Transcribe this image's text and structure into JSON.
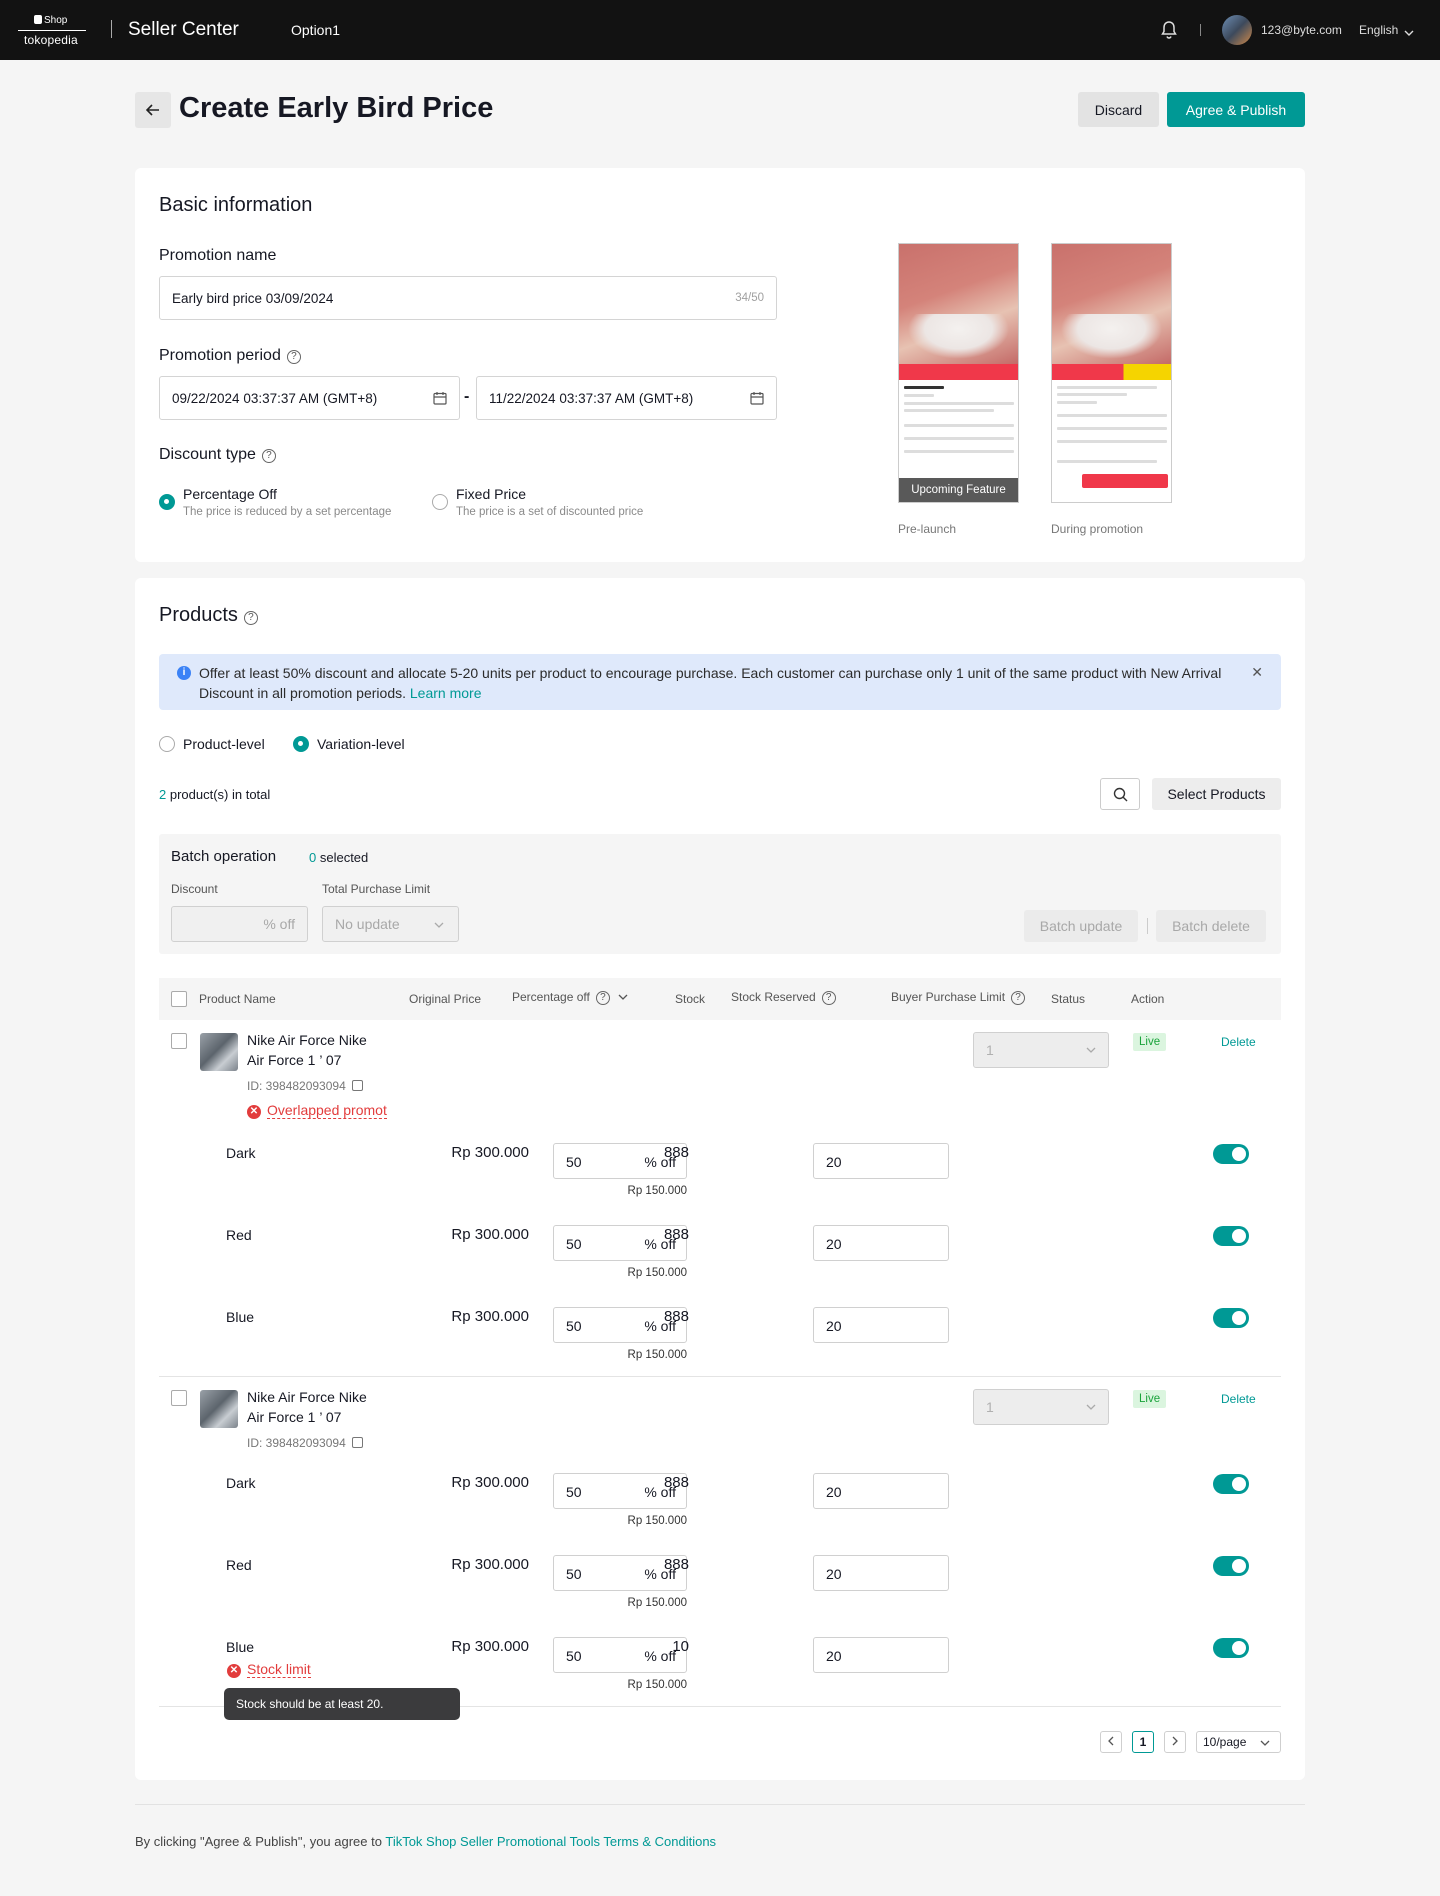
{
  "topbar": {
    "logo_line1": "Shop",
    "logo_line2": "tokopedia",
    "app_title": "Seller Center",
    "option": "Option1",
    "email": "123@byte.com",
    "language": "English"
  },
  "header": {
    "title": "Create Early Bird Price",
    "discard_label": "Discard",
    "publish_label": "Agree & Publish"
  },
  "basic": {
    "section_title": "Basic information",
    "promo_name_label": "Promotion name",
    "promo_name_value": "Early bird price 03/09/2024",
    "promo_name_count": "34/50",
    "period_label": "Promotion period",
    "start": "09/22/2024 03:37:37 AM (GMT+8)",
    "dash": "-",
    "end": "11/22/2024 03:37:37 AM (GMT+8)",
    "discount_type_label": "Discount type",
    "options": [
      {
        "title": "Percentage Off",
        "sub": "The price is reduced by a set percentage",
        "selected": true
      },
      {
        "title": "Fixed Price",
        "sub": "The price is a set of discounted price",
        "selected": false
      }
    ],
    "preview_overlay": "Upcoming Feature",
    "preview_captions": [
      "Pre-launch",
      "During promotion"
    ]
  },
  "products": {
    "section_title": "Products",
    "alert_text": "Offer at least 50% discount and allocate 5-20 units per product to encourage purchase. Each customer can purchase only 1 unit of the same product with New Arrival Discount in all promotion periods.",
    "alert_link": "Learn more",
    "level_options": [
      {
        "label": "Product-level",
        "selected": false
      },
      {
        "label": "Variation-level",
        "selected": true
      }
    ],
    "total_count": "2",
    "total_suffix": " product(s) in total",
    "select_products_label": "Select Products",
    "batch": {
      "title": "Batch operation",
      "selected_count": "0",
      "selected_suffix": " selected",
      "discount_label": "Discount",
      "discount_unit": "% off",
      "limit_label": "Total Purchase Limit",
      "limit_value": "No update",
      "update_label": "Batch update",
      "delete_label": "Batch delete"
    },
    "columns": [
      "Product Name",
      "Original Price",
      "Percentage off",
      "Stock",
      "Stock Reserved",
      "Buyer Purchase Limit",
      "Status",
      "Action"
    ],
    "items": [
      {
        "name": "Nike Air Force Nike Air Force 1 ’ 07",
        "id": "ID: 398482093094",
        "error": "Overlapped promot",
        "limit": "1",
        "status": "Live",
        "action": "Delete",
        "variations": [
          {
            "name": "Dark",
            "price": "Rp 300.000",
            "pct": "50",
            "unit": "% off",
            "disc": "Rp 150.000",
            "stock": "888",
            "reserved": "20",
            "enabled": true
          },
          {
            "name": "Red",
            "price": "Rp 300.000",
            "pct": "50",
            "unit": "% off",
            "disc": "Rp 150.000",
            "stock": "888",
            "reserved": "20",
            "enabled": true
          },
          {
            "name": "Blue",
            "price": "Rp 300.000",
            "pct": "50",
            "unit": "% off",
            "disc": "Rp 150.000",
            "stock": "888",
            "reserved": "20",
            "enabled": true
          }
        ]
      },
      {
        "name": "Nike Air Force Nike Air Force 1 ’ 07",
        "id": "ID: 398482093094",
        "limit": "1",
        "status": "Live",
        "action": "Delete",
        "variations": [
          {
            "name": "Dark",
            "price": "Rp 300.000",
            "pct": "50",
            "unit": "% off",
            "disc": "Rp 150.000",
            "stock": "888",
            "reserved": "20",
            "enabled": true
          },
          {
            "name": "Red",
            "price": "Rp 300.000",
            "pct": "50",
            "unit": "% off",
            "disc": "Rp 150.000",
            "stock": "888",
            "reserved": "20",
            "enabled": true
          },
          {
            "name": "Blue",
            "price": "Rp 300.000",
            "pct": "50",
            "unit": "% off",
            "disc": "Rp 150.000",
            "stock": "10",
            "reserved": "20",
            "enabled": true,
            "error": "Stock limit",
            "tooltip": "Stock should be at least 20."
          }
        ]
      }
    ],
    "pagination": {
      "current": "1",
      "page_size": "10/page"
    }
  },
  "footer": {
    "text": "By clicking \"Agree & Publish\", you agree to ",
    "link": "TikTok Shop Seller Promotional Tools Terms & Conditions"
  },
  "colors": {
    "accent": "#009995",
    "error": "#e23c3c",
    "live": "#1aa33b",
    "info_bg": "#dfe9fb"
  }
}
